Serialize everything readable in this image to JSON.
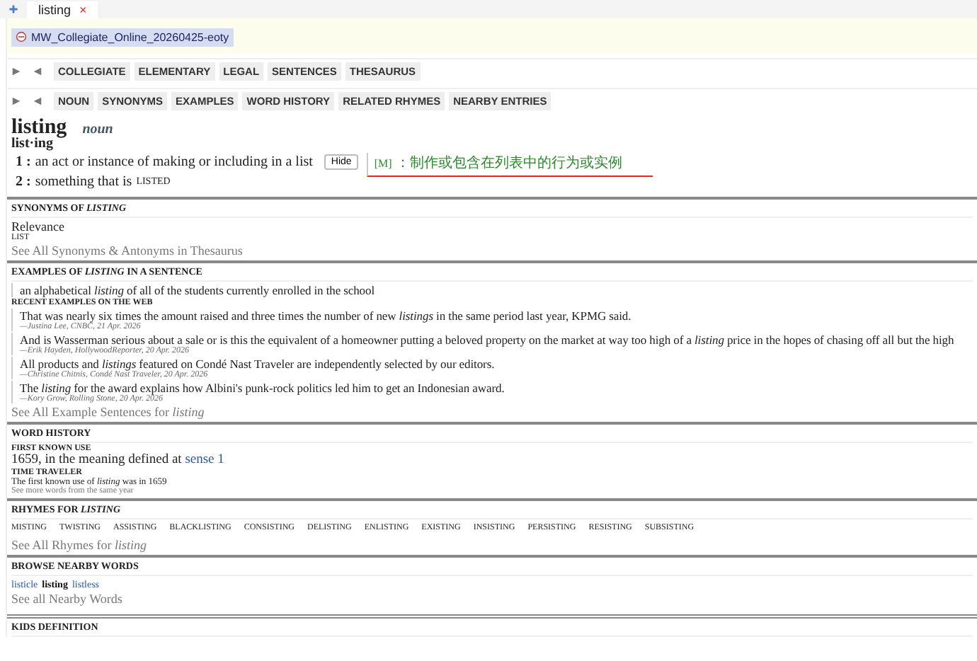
{
  "tabs": [
    {
      "label": "listing",
      "selected": true,
      "close": "×"
    }
  ],
  "source": {
    "label": "MW_Collegiate_Online_20260425-eoty"
  },
  "nav_rows": [
    [
      "COLLEGIATE",
      "ELEMENTARY",
      "LEGAL",
      "SENTENCES",
      "THESAURUS"
    ],
    [
      "NOUN",
      "SYNONYMS",
      "EXAMPLES",
      "WORD HISTORY",
      "RELATED RHYMES",
      "NEARBY ENTRIES"
    ]
  ],
  "entry": {
    "headword": "listing",
    "pos": "noun",
    "syllables": "list·ing",
    "senses": [
      {
        "number": "1 :",
        "text": "an act or instance of making or including in a list",
        "button": "Hide",
        "tag": "[M]",
        "translation": "：制作或包含在列表中的行为或实例"
      },
      {
        "number": "2 :",
        "text": "something that is",
        "xref": "LISTED"
      }
    ]
  },
  "synonyms": {
    "heading": "SYNONYMS OF *LISTING*",
    "sort": "Relevance",
    "words": [
      "LIST"
    ],
    "link": "See All Synonyms & Antonyms in Thesaurus"
  },
  "examples": {
    "heading": "EXAMPLES OF *LISTING* IN A SENTENCE",
    "sentence": "an alphabetical *listing* of all of the students currently enrolled in the school",
    "web_heading": "RECENT EXAMPLES ON THE WEB",
    "items": [
      {
        "text": "That was nearly six times the amount raised and three times the number of new *listings* in the same period last year, KPMG said.",
        "source": "—Justina Lee, CNBC, 21 Apr. 2026"
      },
      {
        "text": "And is Wasserman serious about a sale or is this the equivalent of a homeowner putting a beloved property on the market at way too high of a *listing* price in the hopes of chasing off all but the high",
        "source": "—Erik Hayden, HollywoodReporter, 20 Apr. 2026"
      },
      {
        "text": "All products and *listings* featured on Condé Nast Traveler are independently selected by our editors.",
        "source": "—Christine Chitnis, Condé Nast Traveler, 20 Apr. 2026"
      },
      {
        "text": "The *listing* for the award explains how Albini's punk-rock politics led him to get an Indonesian award.",
        "source": "—Kory Grow, Rolling Stone, 20 Apr. 2026"
      }
    ],
    "link": "See All Example Sentences for *listing*"
  },
  "history": {
    "heading": "WORD HISTORY",
    "first_use_heading": "FIRST KNOWN USE",
    "first_use": "1659, in the meaning defined at",
    "first_use_link": "sense 1",
    "traveler_heading": "TIME TRAVELER",
    "traveler": "The first known use of *listing* was in 1659",
    "traveler_link": "See more words from the same year"
  },
  "rhymes": {
    "heading": "RHYMES FOR *LISTING*",
    "words": [
      "MISTING",
      "TWISTING",
      "ASSISTING",
      "BLACKLISTING",
      "CONSISTING",
      "DELISTING",
      "ENLISTING",
      "EXISTING",
      "INSISTING",
      "PERSISTING",
      "RESISTING",
      "SUBSISTING"
    ],
    "link": "See All Rhymes for *listing*"
  },
  "nearby": {
    "heading": "BROWSE NEARBY WORDS",
    "words": [
      {
        "text": "listicle",
        "selected": false
      },
      {
        "text": "listing",
        "selected": true
      },
      {
        "text": "listless",
        "selected": false
      }
    ],
    "link": "See all Nearby Words"
  },
  "kids": {
    "heading": "KIDS DEFINITION"
  }
}
